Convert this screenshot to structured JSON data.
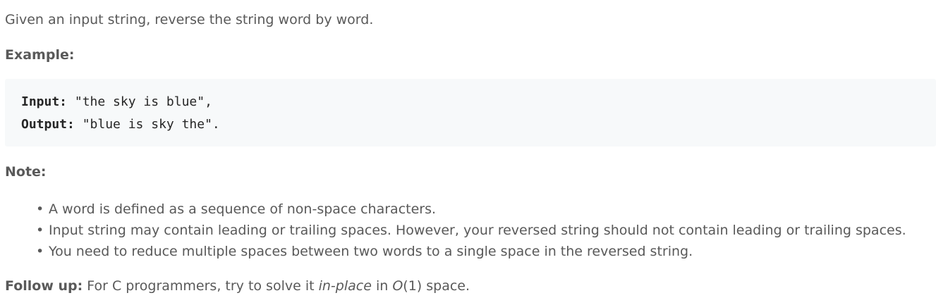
{
  "intro": "Given an input string, reverse the string word by word.",
  "example": {
    "heading": "Example:",
    "input_key": "Input:",
    "input_value": " \"the sky is blue\",",
    "output_key": "Output:",
    "output_value": " \"blue is sky the\"."
  },
  "note": {
    "heading": "Note:",
    "items": [
      "A word is defined as a sequence of non-space characters.",
      "Input string may contain leading or trailing spaces. However, your reversed string should not contain leading or trailing spaces.",
      "You need to reduce multiple spaces between two words to a single space in the reversed string."
    ]
  },
  "follow_up": {
    "lead": "Follow up:",
    "text_before": " For C programmers, try to solve it ",
    "emphasis": "in-place",
    "text_middle": " in ",
    "complexity_symbol": "O",
    "complexity_rest": "(1) space."
  }
}
